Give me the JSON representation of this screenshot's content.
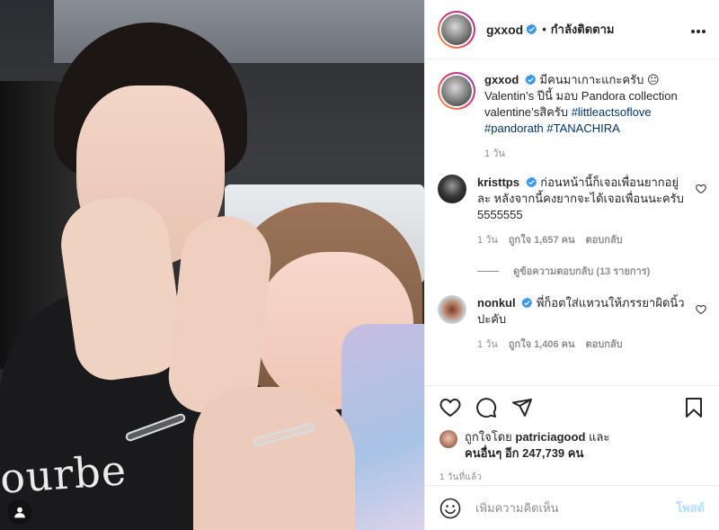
{
  "post": {
    "author": {
      "username": "gxxod",
      "verified": true,
      "separator": "•",
      "follow_status": "กำลังติดตาม",
      "more_icon": "more-horizontal-icon"
    },
    "image": {
      "shirt_text": "ourbe"
    },
    "caption": {
      "username": "gxxod",
      "text": "มีคนมาเกาะแกะครับ 😐 Valentin’s ปีนี้ มอบ Pandora collection valentine’sสิครับ",
      "hashtags": [
        "#littleactsoflove",
        "#pandorath",
        "#TANACHIRA"
      ],
      "time": "1 วัน"
    },
    "comments": [
      {
        "username": "kristtps",
        "verified": true,
        "text": "ก่อนหน้านี้ก็เจอเพื่อนยากอยู่ละ หลังจากนี้คงยากจะได้เจอเพื่อนนะครับ 5555555",
        "time": "1 วัน",
        "likes": "ถูกใจ 1,657 คน",
        "reply": "ตอบกลับ",
        "view_replies": "ดูข้อความตอบกลับ (13 รายการ)"
      },
      {
        "username": "nonkul",
        "verified": true,
        "text": "พี่ก็อตใส่แหวนให้ภรรยาผิดนิ้วปะคับ",
        "time": "1 วัน",
        "likes": "ถูกใจ 1,406 คน",
        "reply": "ตอบกลับ"
      }
    ],
    "actions": {
      "icons": [
        "heart-icon",
        "comment-icon",
        "share-icon",
        "bookmark-icon"
      ]
    },
    "likes_summary": {
      "prefix": "ถูกใจโดย",
      "user": "patriciagood",
      "and": "และ",
      "others": "คนอื่นๆ อีก 247,739 คน"
    },
    "posted_ago": "1 วันที่แล้ว",
    "add_comment": {
      "placeholder": "เพิ่มความคิดเห็น",
      "post_label": "โพสต์"
    }
  }
}
